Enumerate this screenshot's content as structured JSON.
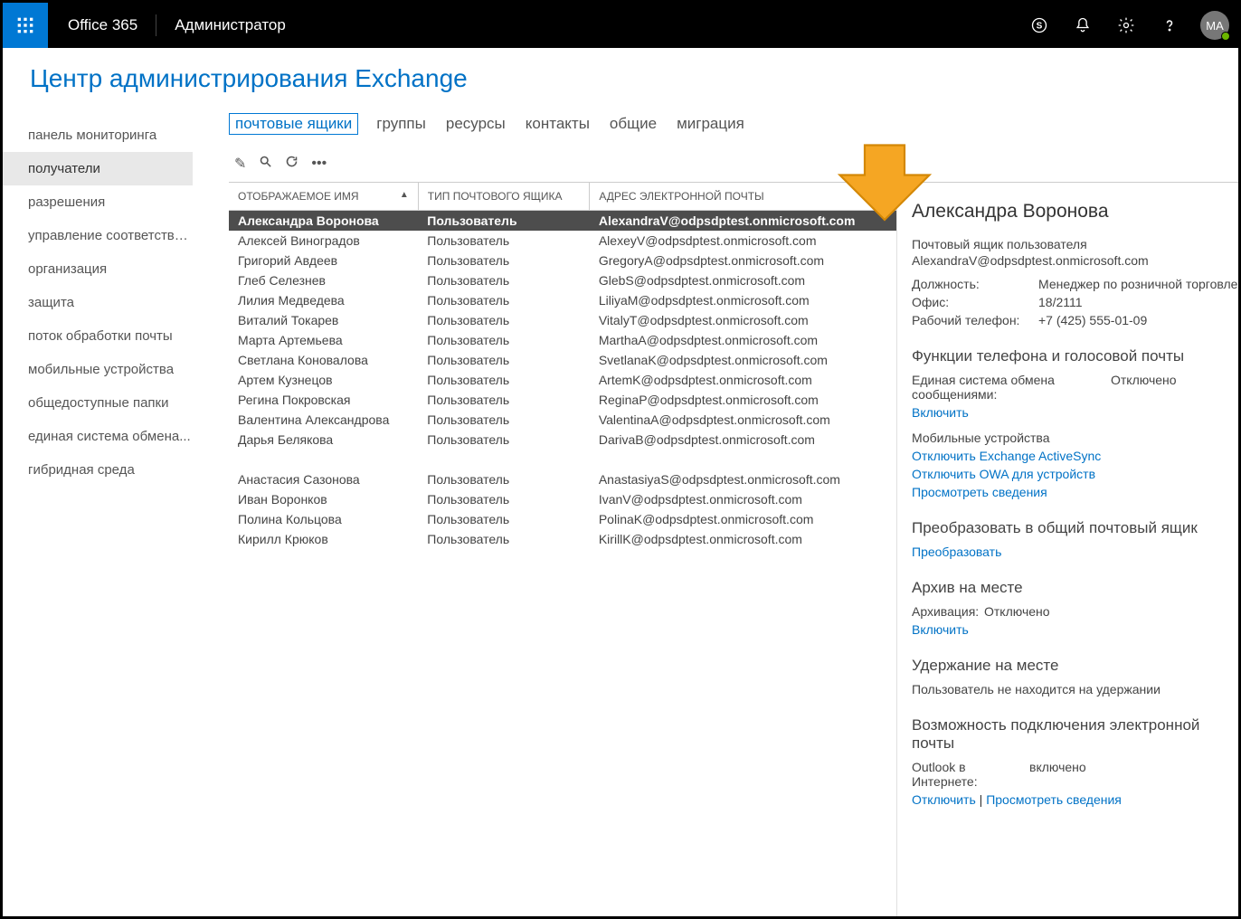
{
  "topbar": {
    "brand": "Office 365",
    "app": "Администратор",
    "avatar_initials": "MA"
  },
  "page_title": "Центр администрирования Exchange",
  "sidebar": {
    "items": [
      "панель мониторинга",
      "получатели",
      "разрешения",
      "управление соответстви...",
      "организация",
      "защита",
      "поток обработки почты",
      "мобильные устройства",
      "общедоступные папки",
      "единая система обмена...",
      "гибридная среда"
    ],
    "active_index": 1
  },
  "tabs": {
    "items": [
      "почтовые ящики",
      "группы",
      "ресурсы",
      "контакты",
      "общие",
      "миграция"
    ],
    "active_index": 0
  },
  "table": {
    "columns": [
      "ОТОБРАЖАЕМОЕ ИМЯ",
      "ТИП ПОЧТОВОГО ЯЩИКА",
      "АДРЕС ЭЛЕКТРОННОЙ ПОЧТЫ"
    ],
    "sort_col": 0,
    "selected_index": 0,
    "rows": [
      {
        "name": "Александра Воронова",
        "type": "Пользователь",
        "email": "AlexandraV@odpsdptest.onmicrosoft.com"
      },
      {
        "name": "Алексей Виноградов",
        "type": "Пользователь",
        "email": "AlexeyV@odpsdptest.onmicrosoft.com"
      },
      {
        "name": "Григорий Авдеев",
        "type": "Пользователь",
        "email": "GregoryA@odpsdptest.onmicrosoft.com"
      },
      {
        "name": "Глеб Селезнев",
        "type": "Пользователь",
        "email": "GlebS@odpsdptest.onmicrosoft.com"
      },
      {
        "name": "Лилия Медведева",
        "type": "Пользователь",
        "email": "LiliyaM@odpsdptest.onmicrosoft.com"
      },
      {
        "name": "Виталий Токарев",
        "type": "Пользователь",
        "email": "VitalyT@odpsdptest.onmicrosoft.com"
      },
      {
        "name": "Марта Артемьева",
        "type": "Пользователь",
        "email": "MarthaA@odpsdptest.onmicrosoft.com"
      },
      {
        "name": "Светлана Коновалова",
        "type": "Пользователь",
        "email": "SvetlanaK@odpsdptest.onmicrosoft.com"
      },
      {
        "name": "Артем Кузнецов",
        "type": "Пользователь",
        "email": "ArtemK@odpsdptest.onmicrosoft.com"
      },
      {
        "name": "Регина Покровская",
        "type": "Пользователь",
        "email": "ReginaP@odpsdptest.onmicrosoft.com"
      },
      {
        "name": "Валентина Александрова",
        "type": "Пользователь",
        "email": "ValentinaA@odpsdptest.onmicrosoft.com"
      },
      {
        "name": "Дарья Белякова",
        "type": "Пользователь",
        "email": "DarivaB@odpsdptest.onmicrosoft.com"
      },
      {
        "blank": true
      },
      {
        "name": "Анастасия Сазонова",
        "type": "Пользователь",
        "email": "AnastasiyaS@odpsdptest.onmicrosoft.com"
      },
      {
        "name": "Иван Воронков",
        "type": "Пользователь",
        "email": "IvanV@odpsdptest.onmicrosoft.com"
      },
      {
        "name": "Полина Кольцова",
        "type": "Пользователь",
        "email": "PolinaK@odpsdptest.onmicrosoft.com"
      },
      {
        "name": "Кирилл Крюков",
        "type": "Пользователь",
        "email": "KirillK@odpsdptest.onmicrosoft.com"
      }
    ]
  },
  "details": {
    "name": "Александра Воронова",
    "mailbox_type_label": "Почтовый ящик пользователя",
    "email": "AlexandraV@odpsdptest.onmicrosoft.com",
    "fields": {
      "title_label": "Должность:",
      "title_value": "Менеджер по розничной торговле",
      "office_label": "Офис:",
      "office_value": "18/2111",
      "phone_label": "Рабочий телефон:",
      "phone_value": "+7 (425) 555-01-09"
    },
    "phone_section": {
      "heading": "Функции телефона и голосовой почты",
      "um_label": "Единая система обмена сообщениями:",
      "um_value": "Отключено",
      "enable_link": "Включить",
      "mobile_heading": "Мобильные устройства",
      "link1": "Отключить Exchange ActiveSync",
      "link2": "Отключить OWA для устройств",
      "link3": "Просмотреть сведения"
    },
    "convert_section": {
      "heading": "Преобразовать в общий почтовый ящик",
      "link": "Преобразовать"
    },
    "archive_section": {
      "heading": "Архив на месте",
      "label": "Архивация:",
      "value": "Отключено",
      "link": "Включить"
    },
    "hold_section": {
      "heading": "Удержание на месте",
      "text": "Пользователь не находится на удержании"
    },
    "connect_section": {
      "heading": "Возможность подключения электронной почты",
      "label": "Outlook в Интернете:",
      "value": "включено",
      "link1": "Отключить",
      "sep": " | ",
      "link2": "Просмотреть сведения"
    }
  }
}
